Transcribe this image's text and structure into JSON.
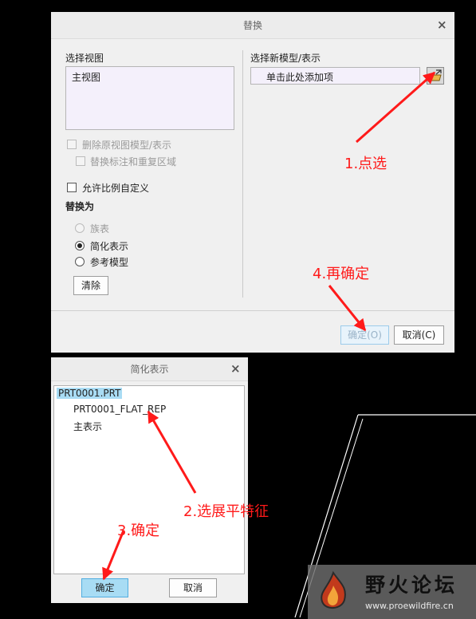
{
  "replace_dialog": {
    "title": "替换",
    "close_glyph": "×",
    "select_view_label": "选择视图",
    "views": [
      "主视图"
    ],
    "select_model_label": "选择新模型/表示",
    "model_placeholder": "单击此处添加项",
    "delete_original_label": "删除原视图模型/表示",
    "replace_annotations_label": "替换标注和重复区域",
    "allow_scale_label": "允许比例自定义",
    "replace_as_label": "替换为",
    "replace_options": [
      "族表",
      "简化表示",
      "参考模型"
    ],
    "selected_option": "简化表示",
    "clear_button": "清除",
    "ok_button": "确定(O)",
    "cancel_button": "取消(C)"
  },
  "simplified_dialog": {
    "title": "简化表示",
    "close_glyph": "×",
    "tree": {
      "root": "PRT0001.PRT",
      "children": [
        "PRT0001_FLAT_REP",
        "主表示"
      ]
    },
    "ok_button": "确定",
    "cancel_button": "取消"
  },
  "annotations": {
    "step1": "1.点选",
    "step2": "2.选展平特征",
    "step3": "3.确定",
    "step4": "4.再确定",
    "color": "#ff1a1a"
  },
  "watermark": {
    "title": "野火论坛",
    "url": "www.proewildfire.cn"
  },
  "icons": {
    "browse": "folder-open-icon",
    "close": "close-icon",
    "logo": "flame-logo-icon"
  }
}
